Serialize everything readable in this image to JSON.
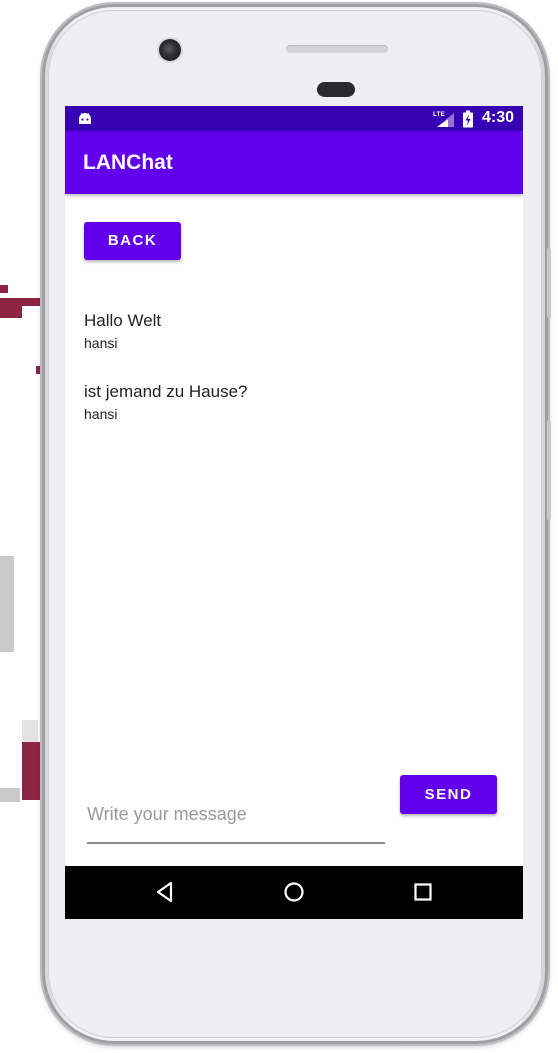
{
  "status_bar": {
    "time": "4:30",
    "network": "LTE",
    "notification_icon": "android-icon",
    "signal_icon": "signal-icon",
    "battery_icon": "battery-charging-icon"
  },
  "app_bar": {
    "title": "LANChat"
  },
  "back_button": {
    "label": "BACK"
  },
  "messages": [
    {
      "text": "Hallo Welt",
      "user": "hansi"
    },
    {
      "text": "ist jemand zu Hause?",
      "user": "hansi"
    }
  ],
  "composer": {
    "placeholder": "Write your message",
    "value": "",
    "send_label": "SEND"
  },
  "nav_bar": {
    "back_icon": "triangle-back-icon",
    "home_icon": "circle-home-icon",
    "recents_icon": "square-recents-icon"
  },
  "colors": {
    "primary": "#6200ee",
    "primary_dark": "#3700b3",
    "on_primary": "#ffffff",
    "text": "#222222",
    "hint": "#9a9a9a"
  }
}
